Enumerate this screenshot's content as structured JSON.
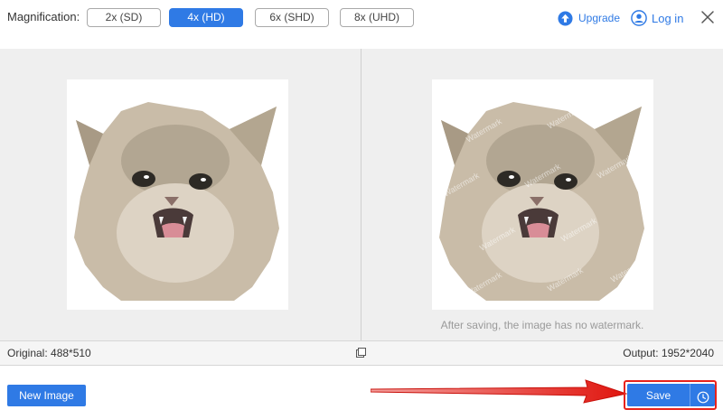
{
  "toolbar": {
    "magnification_label": "Magnification:",
    "options": [
      "2x (SD)",
      "4x (HD)",
      "6x (SHD)",
      "8x (UHD)"
    ],
    "selected": "4x (HD)",
    "upgrade_label": "Upgrade",
    "login_label": "Log in"
  },
  "preview": {
    "note": "After saving, the image has no watermark.",
    "watermark_text": "Watermark"
  },
  "infobar": {
    "original": "Original: 488*510",
    "output": "Output: 1952*2040"
  },
  "bottom": {
    "new_image_label": "New Image",
    "save_label": "Save"
  },
  "colors": {
    "accent": "#2f7ae5",
    "annotation_red": "#e8221b",
    "workspace_bg": "#efefef"
  },
  "icons": [
    "upgrade-icon",
    "user-icon",
    "close-icon",
    "compare-icon",
    "history-icon"
  ]
}
